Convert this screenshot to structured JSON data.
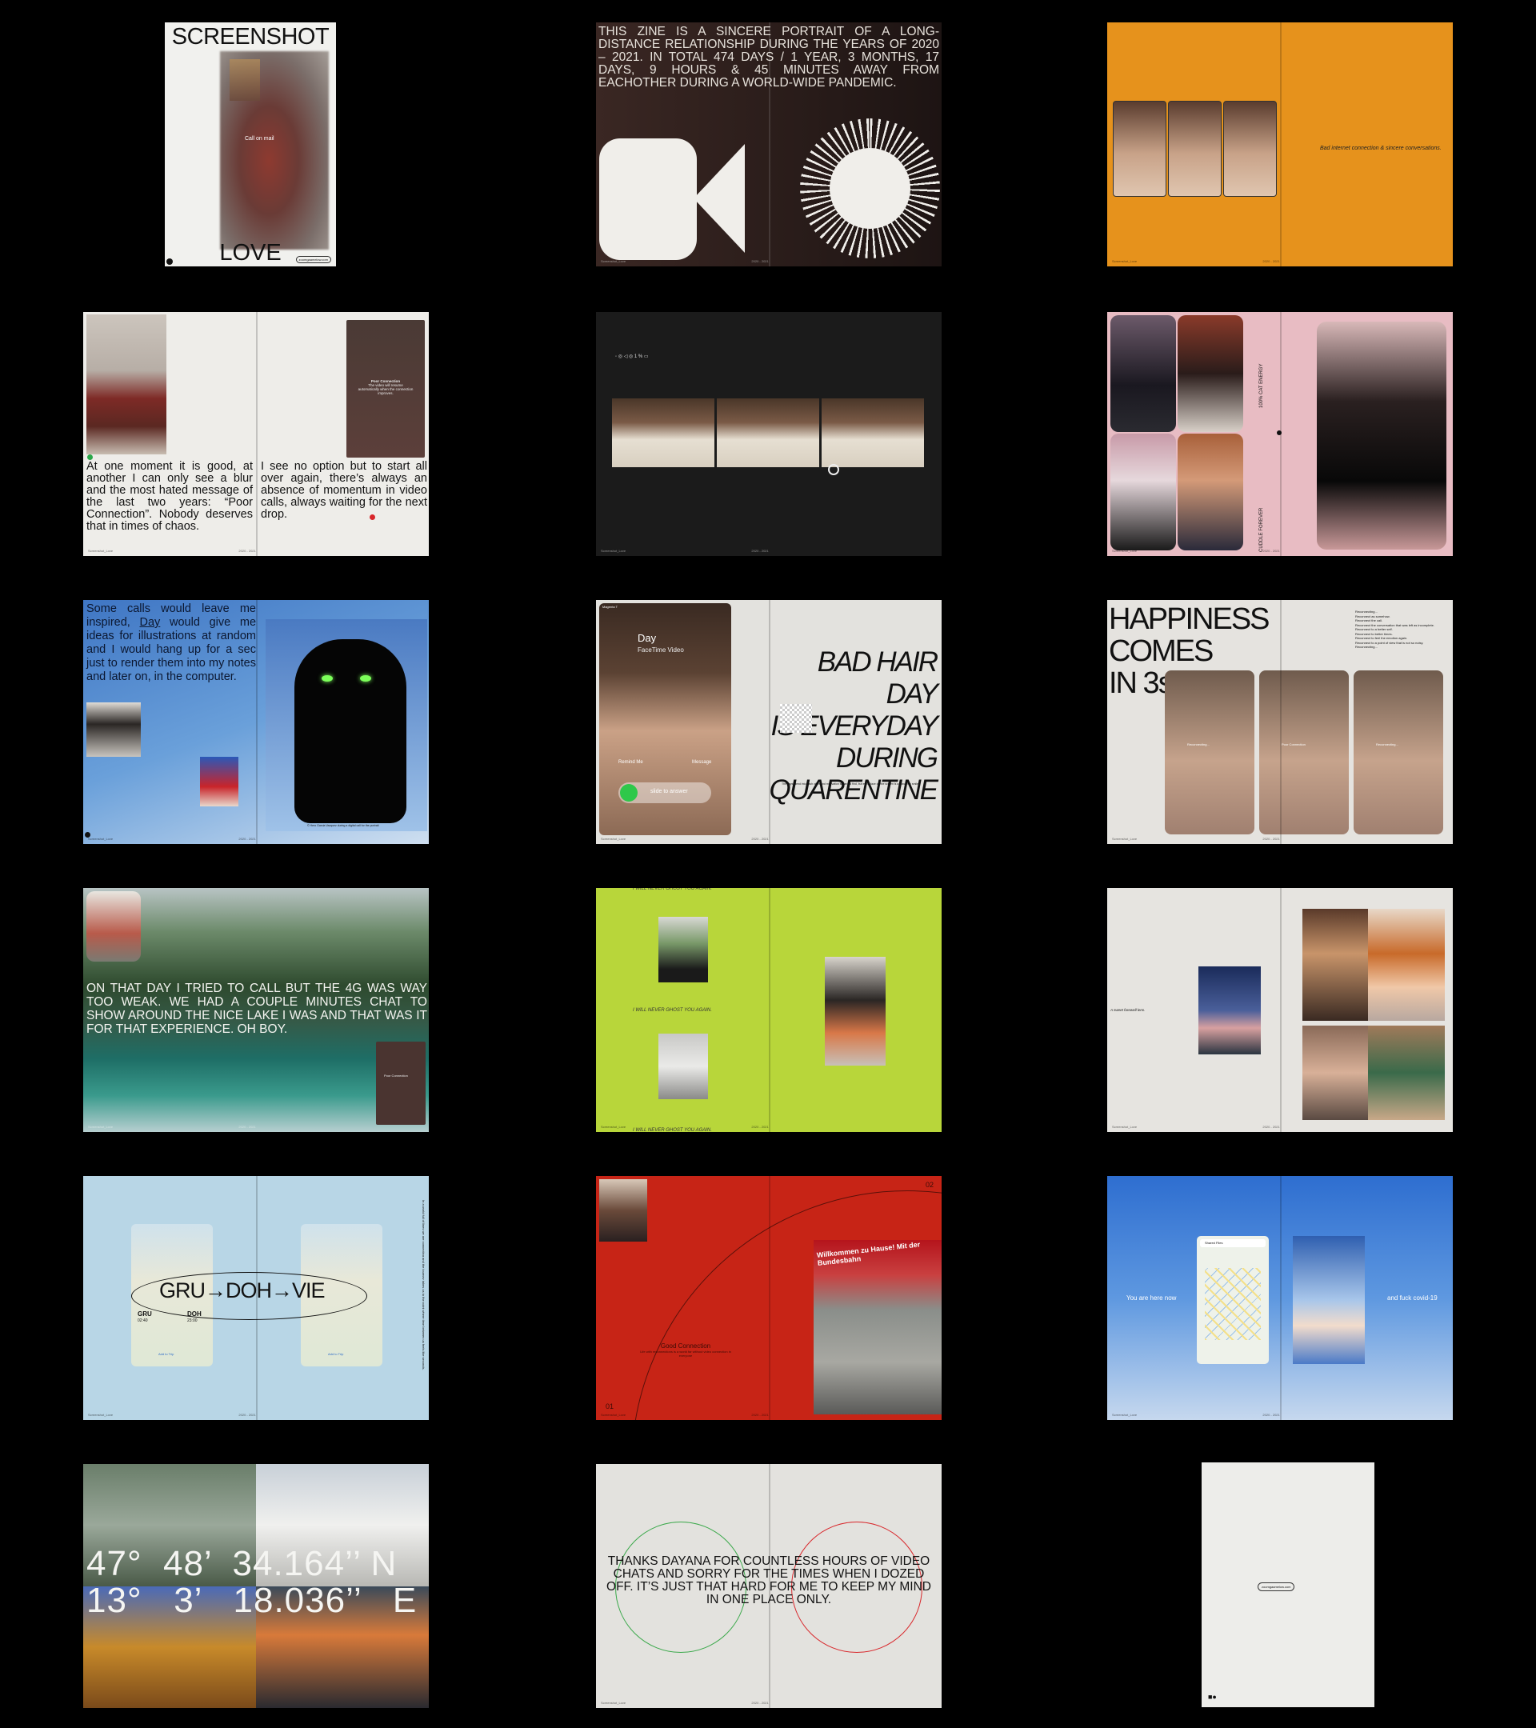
{
  "cover": {
    "title_top": "SCREENSHOT",
    "title_bottom": "LOVE",
    "call_label": "Call on mail",
    "sticker": "zoomgaamelow.com"
  },
  "intro": {
    "text": "THIS ZINE IS A SINCERE PORTRAIT OF A LONG-DISTANCE RELATIONSHIP DURING THE YEARS OF 2020 – 2021. IN TOTAL 474 DAYS / 1 YEAR, 3 MONTHS, 17 DAYS, 9 HOURS & 45 MINUTES AWAY FROM EACHOTHER DURING A WORLD-WIDE PANDEMIC."
  },
  "orange": {
    "note": "Bad internet connection & sincere conversations."
  },
  "poor_connection": {
    "left_text": "At one moment it is good, at another I can only see a blur and the most hated message of the last two years: “Poor Connection”. Nobody deserves that in times of chaos.",
    "right_text": "I see no option but to start all over again, there’s always an absence of momentum in video calls, always waiting for the next drop.",
    "popup_title": "Poor Connection",
    "popup_body": "The video will resume automatically when the connection improves."
  },
  "dark_strip": {
    "status": "◦ ◎ ◁ ◎ 1 % ▭"
  },
  "cats": {
    "vertical_1": "100% CAT ENERGY",
    "vertical_2": "CUDDLE FOREVER"
  },
  "inspiration": {
    "text_before": "Some calls would leave me inspired,",
    "text_link": "Day",
    "text_after": "would give me ideas for illustrations at random and I would hang up for a sec just to render them into my notes and later on, in the computer.",
    "credit": "© Hero Garcia Vazquez during a digital call for the portrait"
  },
  "hair_day": {
    "status": "Magenta T",
    "caller": "Day",
    "call_type": "FaceTime Video",
    "remind": "Remind Me",
    "message": "Message",
    "slide": "slide to answer",
    "headline_1": "BAD HAIR DAY",
    "headline_2": "IS EVERYDAY",
    "headline_3": "DURING",
    "headline_4": "QUARENTINE",
    "caption": "The days blend into each other and motivation is hard to find, but every face on the screen is a reason to smile."
  },
  "happiness": {
    "line_1": "HAPPINESS",
    "line_2": "COMES",
    "line_3": "IN 3s",
    "list": [
      "Reconnecting...",
      "Reconnect as somehow.",
      "Reconnect the call.",
      "Reconnect the conversation that was left as incomplete.",
      "Reconnect to a better self.",
      "Reconnect to better times.",
      "Reconnect to feel the emotion again.",
      "Reconnect to a point of view that is not so noisy.",
      "Reconnecting..."
    ],
    "tile_1": "Reconnecting...",
    "tile_2": "Poor Connection",
    "tile_3": "Reconnecting..."
  },
  "lake": {
    "text": "ON THAT DAY I TRIED TO CALL BUT THE 4G WAS WAY TOO WEAK. WE HAD A COUPLE MINUTES CHAT TO SHOW AROUND THE NICE LAKE I WAS AND THAT WAS IT FOR THAT EXPERIENCE. OH BOY.",
    "popup": "Poor Connection"
  },
  "ghost": {
    "caption": "I WILL NEVER GHOST YOU AGAIN."
  },
  "collage": {
    "caption": "A sweet farewell lens."
  },
  "flights": {
    "route": "GRU→DOH→VIE",
    "from": "GRU",
    "to": "DOH",
    "dep": "02:40",
    "arr": "23:00",
    "add_trip": "Add to Trip",
    "side_note": "In a world full of lines we are connecting and the journey takes us to the point where time between us feels like seconds."
  },
  "airport": {
    "num_top": "02",
    "num_bottom": "01",
    "sign": "Willkommen zu Hause! Mit der Bundesbahn",
    "good": "Good Connection",
    "good_body": "Life with reconnections is a world far without video connection in everyone"
  },
  "map_spread": {
    "left": "You are here now",
    "right": "and fuck covid-19",
    "search": "Shared Files"
  },
  "coords": {
    "line_1": "47°  48’  34.164’’ N",
    "line_2": "13°   3’   18.036’’   E"
  },
  "thanks": {
    "text": "THANKS DAYANA FOR COUNTLESS HOURS OF VIDEO CHATS AND SORRY FOR THE TIMES WHEN I DOZED OFF. IT’S JUST THAT HARD FOR ME TO KEEP MY MIND IN ONE PLACE ONLY."
  },
  "back_cover": {
    "sticker": "zoomgaamelow.com",
    "logo": "■●"
  },
  "footer": {
    "left": "Screenshot_Love",
    "mid": "2020 - 2021"
  }
}
